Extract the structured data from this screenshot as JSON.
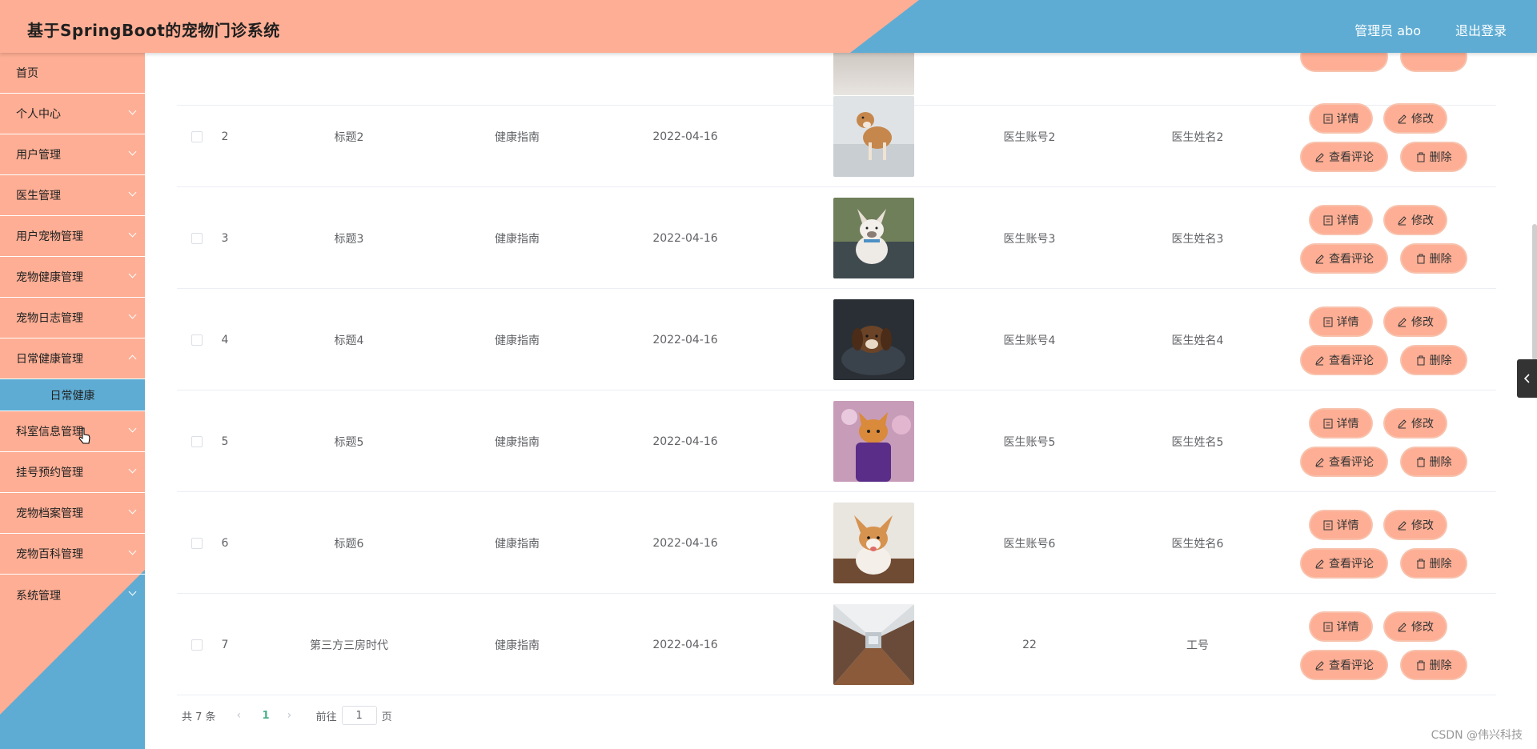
{
  "header": {
    "title": "基于SpringBoot的宠物门诊系统",
    "user": "管理员 abo",
    "logout": "退出登录"
  },
  "sidebar": {
    "items": [
      {
        "label": "首页",
        "chevron": false
      },
      {
        "label": "个人中心",
        "chevron": true
      },
      {
        "label": "用户管理",
        "chevron": true
      },
      {
        "label": "医生管理",
        "chevron": true
      },
      {
        "label": "用户宠物管理",
        "chevron": true
      },
      {
        "label": "宠物健康管理",
        "chevron": true
      },
      {
        "label": "宠物日志管理",
        "chevron": true
      },
      {
        "label": "日常健康管理",
        "chevron": true
      }
    ],
    "submenu": "日常健康",
    "items2": [
      {
        "label": "科室信息管理",
        "chevron": true
      },
      {
        "label": "挂号预约管理",
        "chevron": true
      },
      {
        "label": "宠物档案管理",
        "chevron": true
      },
      {
        "label": "宠物百科管理",
        "chevron": true
      },
      {
        "label": "系统管理",
        "chevron": true
      }
    ]
  },
  "table": {
    "rows": [
      {
        "no": "2",
        "title": "标题2",
        "category": "健康指南",
        "date": "2022-04-16",
        "account": "医生账号2",
        "name": "医生姓名2",
        "image": "shiba-dog"
      },
      {
        "no": "3",
        "title": "标题3",
        "category": "健康指南",
        "date": "2022-04-16",
        "account": "医生账号3",
        "name": "医生姓名3",
        "image": "french-bulldog"
      },
      {
        "no": "4",
        "title": "标题4",
        "category": "健康指南",
        "date": "2022-04-16",
        "account": "医生账号4",
        "name": "医生姓名4",
        "image": "dark-puppy"
      },
      {
        "no": "5",
        "title": "标题5",
        "category": "健康指南",
        "date": "2022-04-16",
        "account": "医生账号5",
        "name": "医生姓名5",
        "image": "orange-cat"
      },
      {
        "no": "6",
        "title": "标题6",
        "category": "健康指南",
        "date": "2022-04-16",
        "account": "医生账号6",
        "name": "医生姓名6",
        "image": "corgi-puppy"
      },
      {
        "no": "7",
        "title": "第三方三房时代",
        "category": "健康指南",
        "date": "2022-04-16",
        "account": "22",
        "name": "工号",
        "image": "clinic-hallway"
      }
    ],
    "actions": {
      "detail": "详情",
      "edit": "修改",
      "comments": "查看评论",
      "delete": "删除"
    }
  },
  "pagination": {
    "total": "共 7 条",
    "current": "1",
    "goto_prefix": "前往",
    "goto_value": "1",
    "goto_suffix": "页"
  },
  "watermark": "CSDN @伟兴科技",
  "colors": {
    "salmon": "#fdae94",
    "blue": "#5eacd3",
    "page_active": "#4caf8a"
  }
}
